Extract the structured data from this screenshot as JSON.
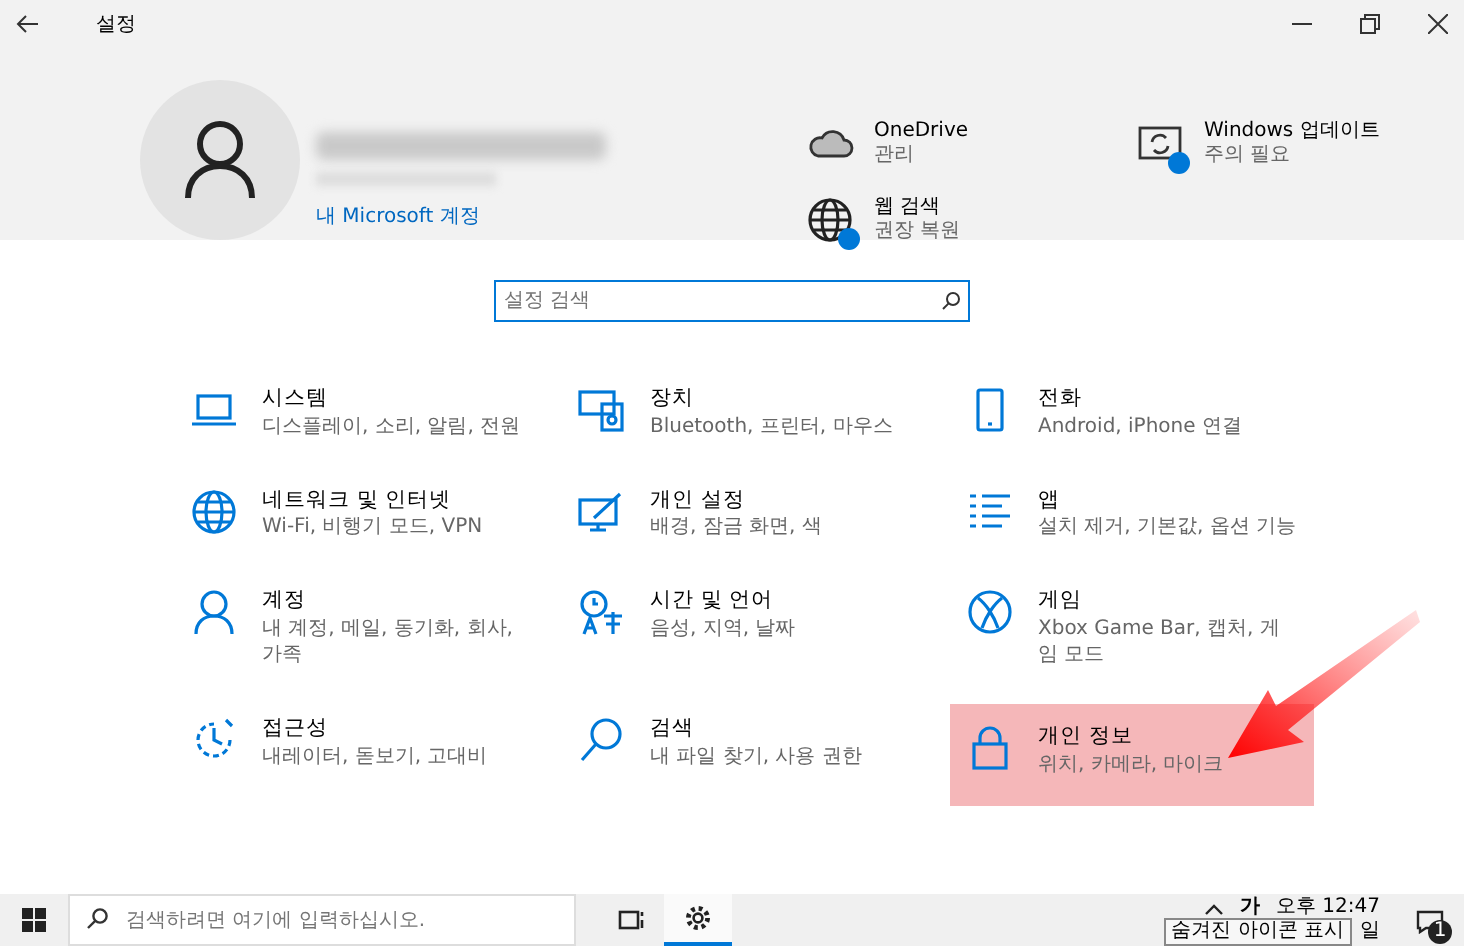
{
  "window": {
    "title": "설정"
  },
  "account": {
    "link": "내 Microsoft 계정"
  },
  "quick_links": [
    {
      "title": "OneDrive",
      "subtitle": "관리",
      "badge": false
    },
    {
      "title": "Windows 업데이트",
      "subtitle": "주의 필요",
      "badge": true
    },
    {
      "title": "웹 검색",
      "subtitle": "권장 복원",
      "badge": true
    }
  ],
  "search": {
    "placeholder": "설정 검색"
  },
  "categories": [
    {
      "title": "시스템",
      "subtitle": "디스플레이, 소리, 알림, 전원",
      "selected": false
    },
    {
      "title": "장치",
      "subtitle": "Bluetooth, 프린터, 마우스",
      "selected": false
    },
    {
      "title": "전화",
      "subtitle": "Android, iPhone 연결",
      "selected": false
    },
    {
      "title": "네트워크 및 인터넷",
      "subtitle": "Wi-Fi, 비행기 모드, VPN",
      "selected": false
    },
    {
      "title": "개인 설정",
      "subtitle": "배경, 잠금 화면, 색",
      "selected": false
    },
    {
      "title": "앱",
      "subtitle": "설치 제거, 기본값, 옵션 기능",
      "selected": false
    },
    {
      "title": "계정",
      "subtitle": "내 계정, 메일, 동기화, 회사, 가족",
      "selected": false
    },
    {
      "title": "시간 및 언어",
      "subtitle": "음성, 지역, 날짜",
      "selected": false
    },
    {
      "title": "게임",
      "subtitle": "Xbox Game Bar, 캡처, 게임 모드",
      "selected": false
    },
    {
      "title": "접근성",
      "subtitle": "내레이터, 돋보기, 고대비",
      "selected": false
    },
    {
      "title": "검색",
      "subtitle": "내 파일 찾기, 사용 권한",
      "selected": false
    },
    {
      "title": "개인 정보",
      "subtitle": "위치, 카메라, 마이크",
      "selected": true
    }
  ],
  "taskbar": {
    "search_placeholder": "검색하려면 여기에 입력하십시오.",
    "apps": [
      {
        "selected": false
      },
      {
        "selected": true
      }
    ],
    "ime": "가",
    "time": "오후 12:47",
    "date": "일",
    "notifications": "1",
    "tooltip": "숨겨진 아이콘 표시"
  }
}
